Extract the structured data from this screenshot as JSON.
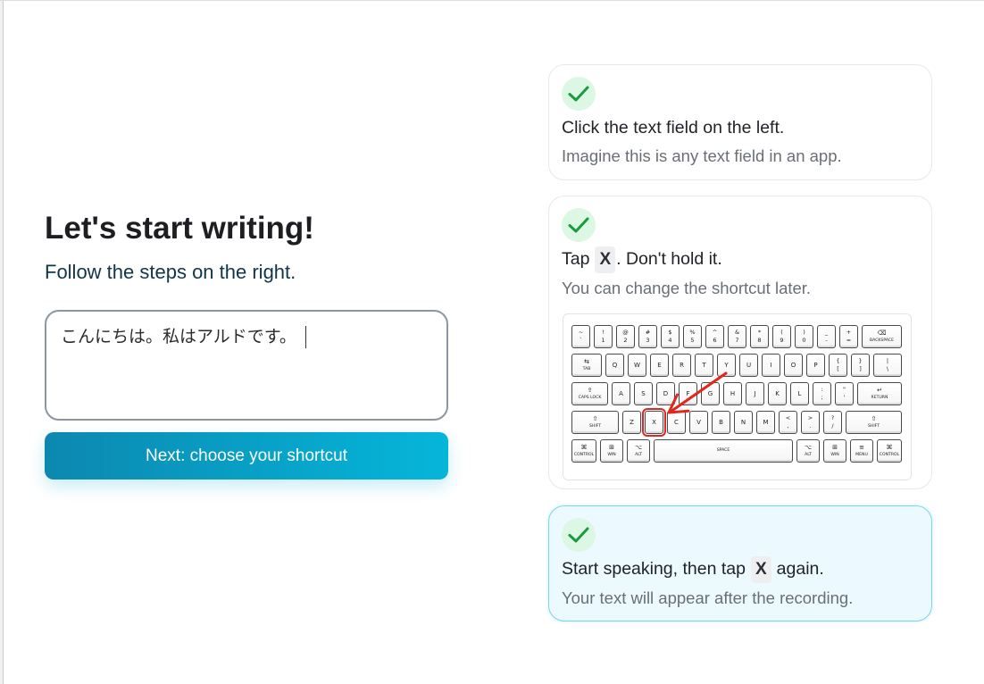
{
  "left": {
    "heading": "Let's start writing!",
    "subheading": "Follow the steps on the right.",
    "text_field_value": "こんにちは。私はアルドです。",
    "next_button_label": "Next: choose your shortcut"
  },
  "steps": [
    {
      "completed": true,
      "status_icon": "check-icon",
      "title": "Click the text field on the left.",
      "description": "Imagine this is any text field in an app."
    },
    {
      "completed": true,
      "status_icon": "check-icon",
      "title_before": "Tap",
      "shortcut_key": "X",
      "title_after": ". Don't hold it.",
      "description": "You can change the shortcut later.",
      "keyboard": {
        "rows": [
          [
            {
              "top": "~",
              "bottom": "`"
            },
            {
              "top": "!",
              "bottom": "1"
            },
            {
              "top": "@",
              "bottom": "2"
            },
            {
              "top": "#",
              "bottom": "3"
            },
            {
              "top": "$",
              "bottom": "4"
            },
            {
              "top": "%",
              "bottom": "5"
            },
            {
              "top": "^",
              "bottom": "6"
            },
            {
              "top": "&",
              "bottom": "7"
            },
            {
              "top": "*",
              "bottom": "8"
            },
            {
              "top": "(",
              "bottom": "9"
            },
            {
              "top": ")",
              "bottom": "0"
            },
            {
              "top": "_",
              "bottom": "-"
            },
            {
              "top": "+",
              "bottom": "="
            },
            {
              "symbol": "⌫",
              "label": "BACKSPACE"
            }
          ],
          [
            {
              "symbol": "⇆",
              "label": "TAB"
            },
            {
              "main": "Q"
            },
            {
              "main": "W"
            },
            {
              "main": "E"
            },
            {
              "main": "R"
            },
            {
              "main": "T"
            },
            {
              "main": "Y"
            },
            {
              "main": "U"
            },
            {
              "main": "I"
            },
            {
              "main": "O"
            },
            {
              "main": "P"
            },
            {
              "top": "{",
              "bottom": "["
            },
            {
              "top": "}",
              "bottom": "]"
            },
            {
              "top": "|",
              "bottom": "\\"
            }
          ],
          [
            {
              "symbol": "⇪",
              "label": "CAPS LOCK"
            },
            {
              "main": "A"
            },
            {
              "main": "S"
            },
            {
              "main": "D"
            },
            {
              "main": "F"
            },
            {
              "main": "G"
            },
            {
              "main": "H"
            },
            {
              "main": "J"
            },
            {
              "main": "K"
            },
            {
              "main": "L"
            },
            {
              "top": ":",
              "bottom": ";"
            },
            {
              "top": "\"",
              "bottom": "'"
            },
            {
              "symbol": "↵",
              "label": "RETURN"
            }
          ],
          [
            {
              "symbol": "⇧",
              "label": "SHIFT"
            },
            {
              "main": "Z"
            },
            {
              "main": "X",
              "highlighted": true
            },
            {
              "main": "C"
            },
            {
              "main": "V"
            },
            {
              "main": "B"
            },
            {
              "main": "N"
            },
            {
              "main": "M"
            },
            {
              "top": "<",
              "bottom": ","
            },
            {
              "top": ">",
              "bottom": "."
            },
            {
              "top": "?",
              "bottom": "/"
            },
            {
              "symbol": "⇧",
              "label": "SHIFT"
            }
          ],
          [
            {
              "symbol": "⌘",
              "label": "CONTROL"
            },
            {
              "symbol": "⊞",
              "label": "WIN"
            },
            {
              "symbol": "⌥",
              "label": "ALT"
            },
            {
              "label": "SPACE"
            },
            {
              "symbol": "⌥",
              "label": "ALT"
            },
            {
              "symbol": "⊞",
              "label": "WIN"
            },
            {
              "symbol": "≡",
              "label": "MENU"
            },
            {
              "symbol": "⌘",
              "label": "CONTROL"
            }
          ]
        ]
      }
    },
    {
      "completed": true,
      "active": true,
      "status_icon": "check-icon",
      "title_before": "Start speaking, then tap",
      "shortcut_key": "X",
      "title_after": "again.",
      "description": "Your text will appear after the recording."
    }
  ],
  "colors": {
    "accent_start": "#0c88b0",
    "accent_end": "#05b6da",
    "check": "#1b9a3e",
    "check_bg": "#dcf7e3",
    "active_card_bg": "#ecfaff",
    "active_card_border": "#7ad3e9",
    "highlight": "#e2261b"
  }
}
